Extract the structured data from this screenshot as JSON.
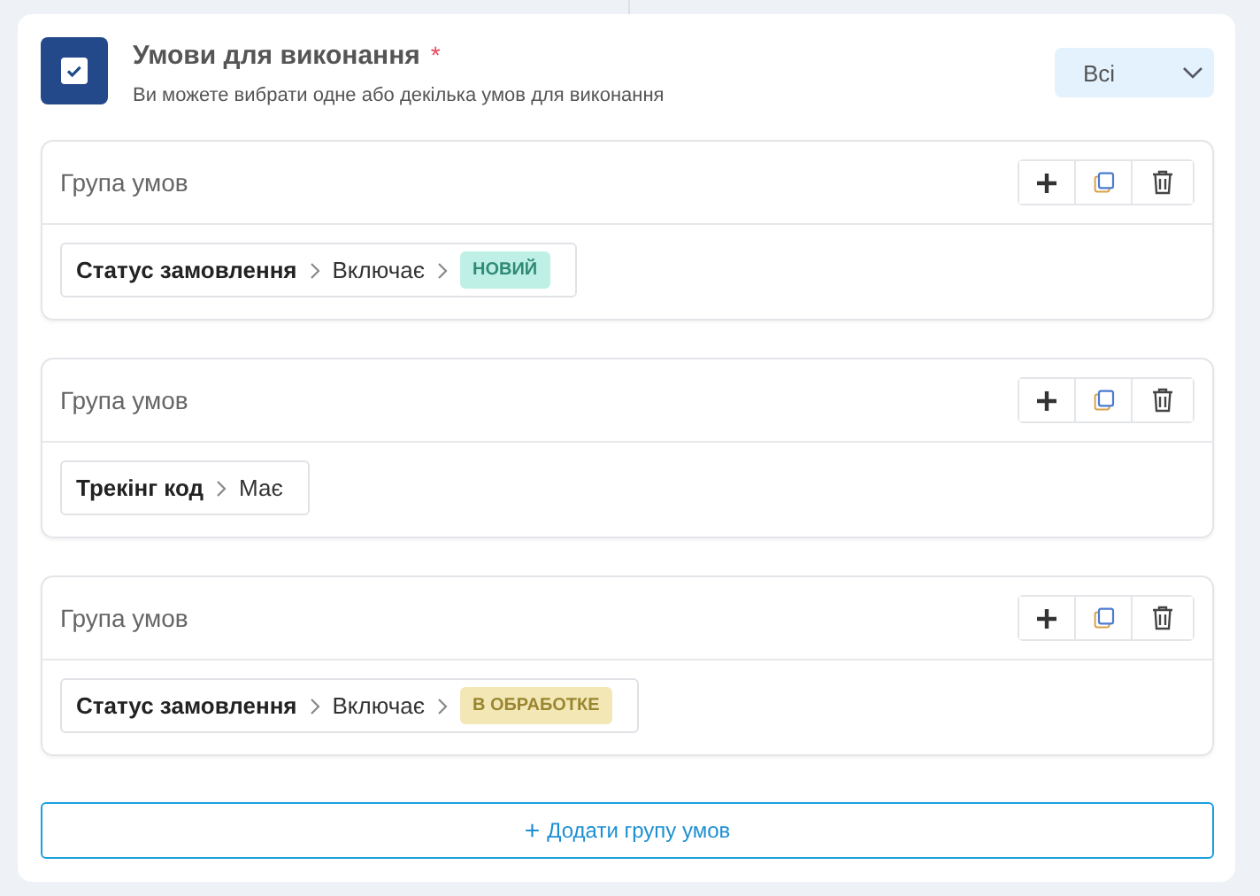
{
  "header": {
    "title": "Умови для виконання",
    "required_mark": "*",
    "subtitle": "Ви можете вибрати одне або декілька умов для виконання",
    "checked": true
  },
  "mode_select": {
    "value": "Всі"
  },
  "groups": [
    {
      "title": "Група умов",
      "condition": {
        "field": "Статус замовлення",
        "operator": "Включає",
        "tag": {
          "label": "НОВИЙ",
          "color": "#bff0e6"
        }
      }
    },
    {
      "title": "Група умов",
      "condition": {
        "field": "Трекінг код",
        "operator": "Має"
      }
    },
    {
      "title": "Група умов",
      "condition": {
        "field": "Статус замовлення",
        "operator": "Включає",
        "tag": {
          "label": "В ОБРАБОТКЕ",
          "color": "#f3e8b5"
        }
      }
    }
  ],
  "add_group_button": {
    "icon": "+",
    "label": "Додати групу умов"
  }
}
